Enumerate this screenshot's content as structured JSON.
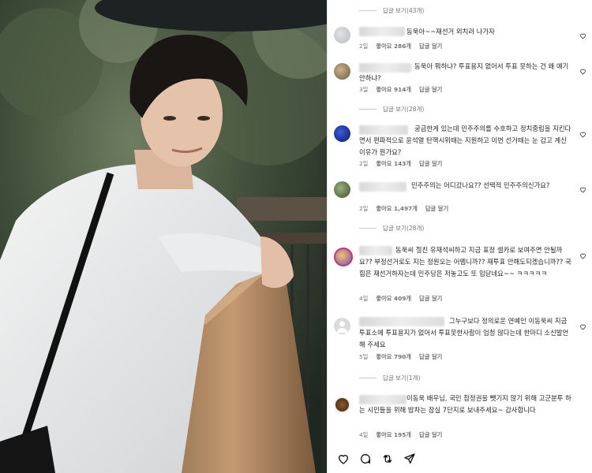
{
  "top_reply": {
    "label": "답글 보기(43개)"
  },
  "comments": [
    {
      "text": "동욱아~~재선거 외치러 나가자",
      "age": "2일",
      "likes": "좋아요 286개",
      "reply": "답글 달기"
    },
    {
      "text": "동욱아 뭐하냐? 투표용지 없어서 투표 못하는 건 왜 얘기 안하냐?",
      "age": "3일",
      "likes": "좋아요 914개",
      "reply": "답글 달기",
      "replies_label": "답글 보기(28개)"
    },
    {
      "text": "궁금한게 있는데 민주주의를 수호하고 정치중립을 지킨다면서 편파적으로 윤석열 탄핵시위때는 지원하고 이번 선거때는 눈 감고 계신 이유가 뭔가요?",
      "age": "2일",
      "likes": "좋아요 143개",
      "reply": "답글 달기"
    },
    {
      "text": "민주주의는 어디갔나요?? 선택적 민주주의신가요?",
      "age": "2일",
      "likes": "좋아요 1,497개",
      "reply": "답글 달기",
      "replies_label": "답글 보기(28개)"
    },
    {
      "text": "동욱씨 절친 유재석씨하고 지금 표정 셀카로 보여주면 안될까요?? 부정선거로도 지는 정원오는 어뗍니까?? 재투표 안해도되겠습니까?? 국힘은 재선거하자는데 민주당은 저놓고도 또 입닫네요~~ ㅋㅋㅋㅋㅋ",
      "age": "4일",
      "likes": "좋아요 409개",
      "reply": "답글 달기"
    },
    {
      "text": "그누구보다 정의로운 연예인 이동욱씨 지금 투표소에 투표용지가 없어서 투표못한사람이 엄청 많다는데 한마디 소신발언 해 주세요",
      "age": "5일",
      "likes": "좋아요 790개",
      "reply": "답글 달기",
      "replies_label": "답글 보기(1개)"
    },
    {
      "text": "이동욱 배우님, 국민 참정권을 뺏기지 않기 위해 고군분투 하는 시민들을 위해 밥차는 잠실 7단지로 보내주세요~ 감사합니다",
      "age": "4일",
      "likes": "좋아요 195개",
      "reply": "답글 달기"
    }
  ],
  "action_icons": [
    "heart-icon",
    "comment-icon",
    "repost-icon",
    "share-icon"
  ]
}
